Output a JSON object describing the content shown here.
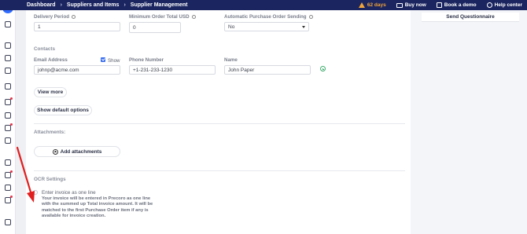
{
  "header": {
    "breadcrumbs": [
      "Dashboard",
      "Suppliers and Items",
      "Supplier Management"
    ],
    "trial_days": "62 days",
    "buy_now": "Buy now",
    "book_demo": "Book a demo",
    "help_center": "Help center"
  },
  "right_panel": {
    "send_questionnaire": "Send Questionnaire"
  },
  "form": {
    "delivery_period_label": "Delivery Period",
    "delivery_period_value": "1",
    "min_order_label": "Minimum Order Total USD",
    "min_order_value": "0",
    "auto_po_label": "Automatic Purchase Order Sending",
    "auto_po_value": "No"
  },
  "contacts": {
    "title": "Contacts",
    "email_label": "Email Address",
    "show_label": "Show",
    "email_value": "johnp@acme.com",
    "phone_label": "Phone Number",
    "phone_value": "+1-231-233-1230",
    "name_label": "Name",
    "name_value": "John Paper"
  },
  "buttons": {
    "view_more": "View more",
    "show_default": "Show default options",
    "add_attachments": "Add attachments"
  },
  "attachments": {
    "title": "Attachments:"
  },
  "ocr": {
    "title": "OCR Settings",
    "option_label": "Enter invoice as one line",
    "description": [
      "Your invoice will be entered in Precoro as one line",
      "with the summed up Total invoice amount. It will be",
      "matched to the first Purchase Order item if any is",
      "available for invoice creation."
    ]
  },
  "colors": {
    "topbar": "#1b2560",
    "accent": "#3b6ff0",
    "warning": "#f0a43a",
    "arrow": "#e02020"
  }
}
